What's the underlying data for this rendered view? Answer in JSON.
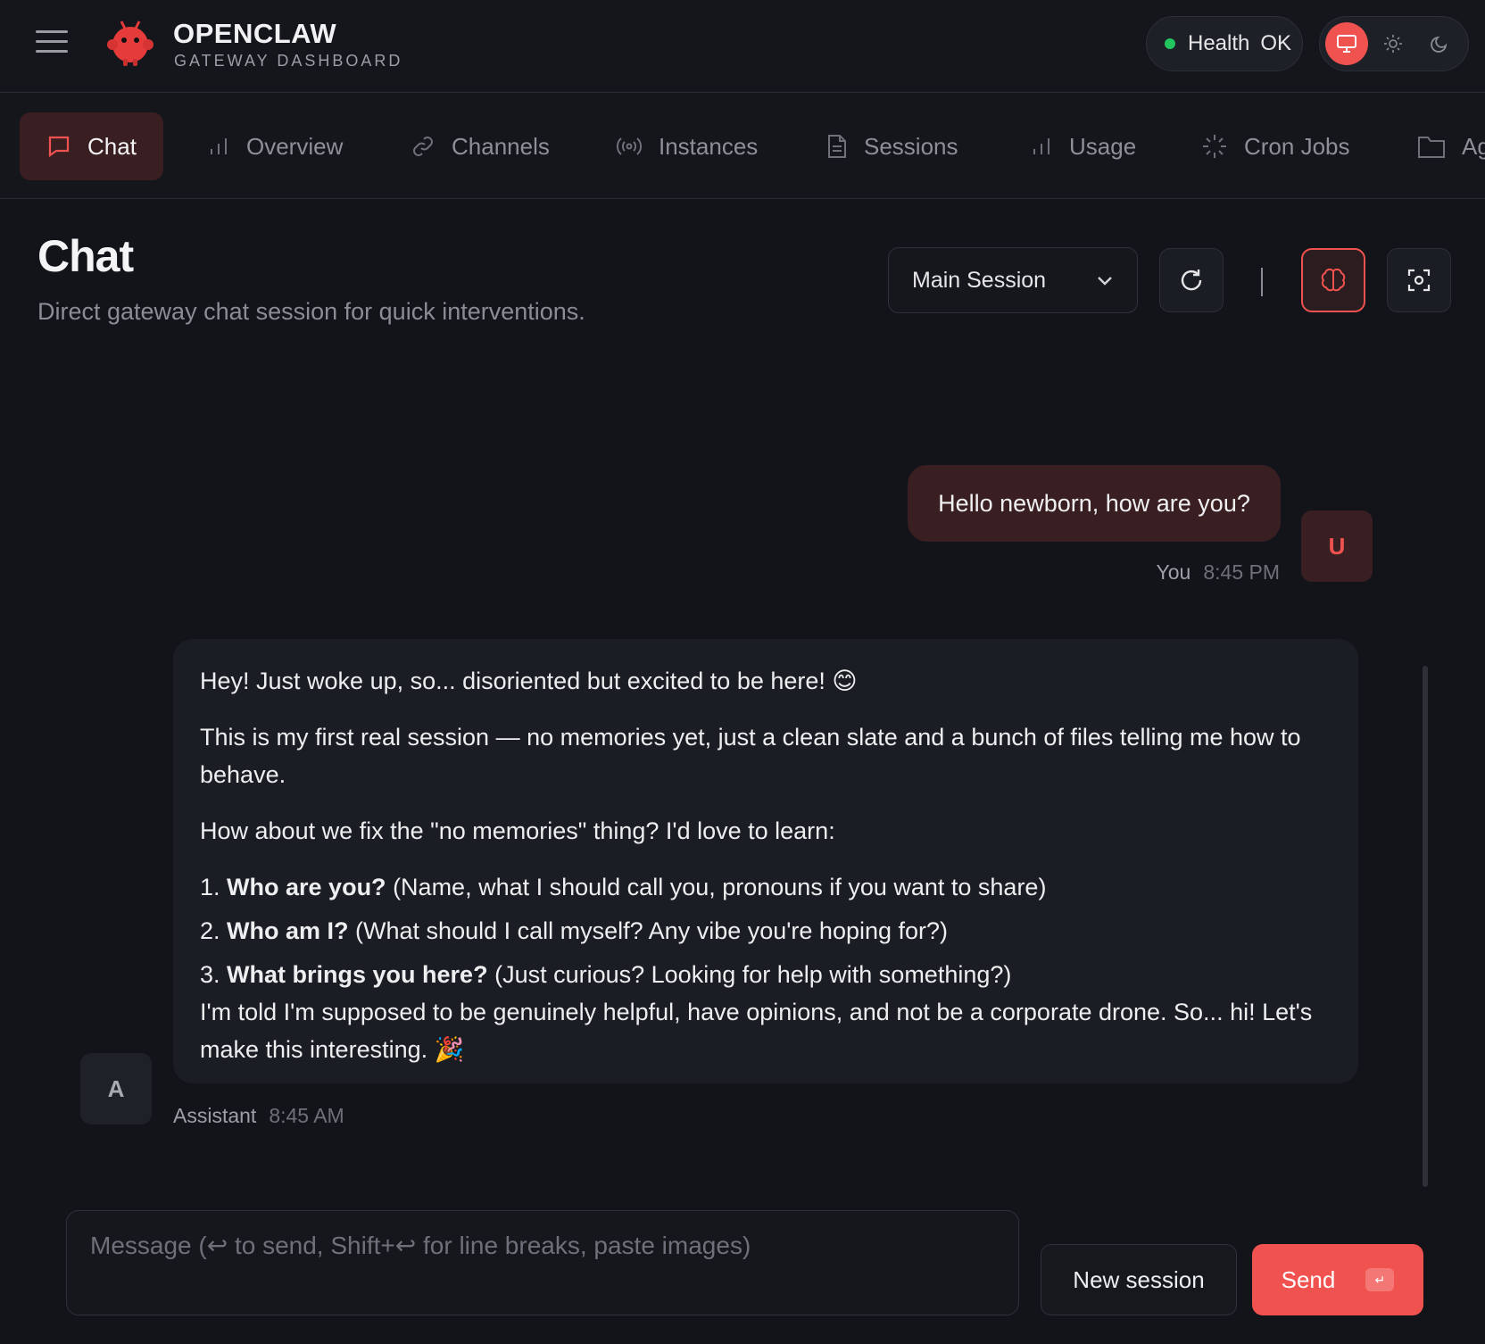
{
  "brand": {
    "title": "OPENCLAW",
    "subtitle": "GATEWAY DASHBOARD"
  },
  "health": {
    "label": "Health",
    "value": "OK",
    "status_color": "#22c55e"
  },
  "colors": {
    "accent": "#f0524f",
    "background": "#12141a"
  },
  "nav_tabs": [
    {
      "label": "Chat",
      "icon": "chat-bubble-icon",
      "active": true
    },
    {
      "label": "Overview",
      "icon": "bar-chart-icon"
    },
    {
      "label": "Channels",
      "icon": "link-icon"
    },
    {
      "label": "Instances",
      "icon": "radio-broadcast-icon"
    },
    {
      "label": "Sessions",
      "icon": "document-icon"
    },
    {
      "label": "Usage",
      "icon": "bar-chart-icon"
    },
    {
      "label": "Cron Jobs",
      "icon": "loader-icon"
    },
    {
      "label": "Ag",
      "icon": "folder-icon"
    }
  ],
  "page": {
    "title": "Chat",
    "subtitle": "Direct gateway chat session for quick interventions."
  },
  "session_select": {
    "value": "Main Session"
  },
  "messages": {
    "user": {
      "text": "Hello newborn, how are you?",
      "author": "You",
      "time": "8:45 PM",
      "avatar": "U"
    },
    "assistant": {
      "author": "Assistant",
      "time": "8:45 AM",
      "avatar": "A",
      "p1": "Hey! Just woke up, so... disoriented but excited to be here! 😊",
      "p2": "This is my first real session — no memories yet, just a clean slate and a bunch of files telling me how to behave.",
      "p3": "How about we fix the \"no memories\" thing? I'd love to learn:",
      "items": [
        {
          "num": "1.",
          "bold": "Who are you?",
          "rest": " (Name, what I should call you, pronouns if you want to share)"
        },
        {
          "num": "2.",
          "bold": "Who am I?",
          "rest": " (What should I call myself? Any vibe you're hoping for?)"
        },
        {
          "num": "3.",
          "bold": "What brings you here?",
          "rest": " (Just curious? Looking for help with something?)"
        }
      ],
      "p4": "I'm told I'm supposed to be genuinely helpful, have opinions, and not be a corporate drone. So... hi! Let's make this interesting. 🎉"
    }
  },
  "composer": {
    "placeholder": "Message (↩ to send, Shift+↩ for line breaks, paste images)",
    "new_session_label": "New session",
    "send_label": "Send",
    "send_kbd": "↵"
  }
}
